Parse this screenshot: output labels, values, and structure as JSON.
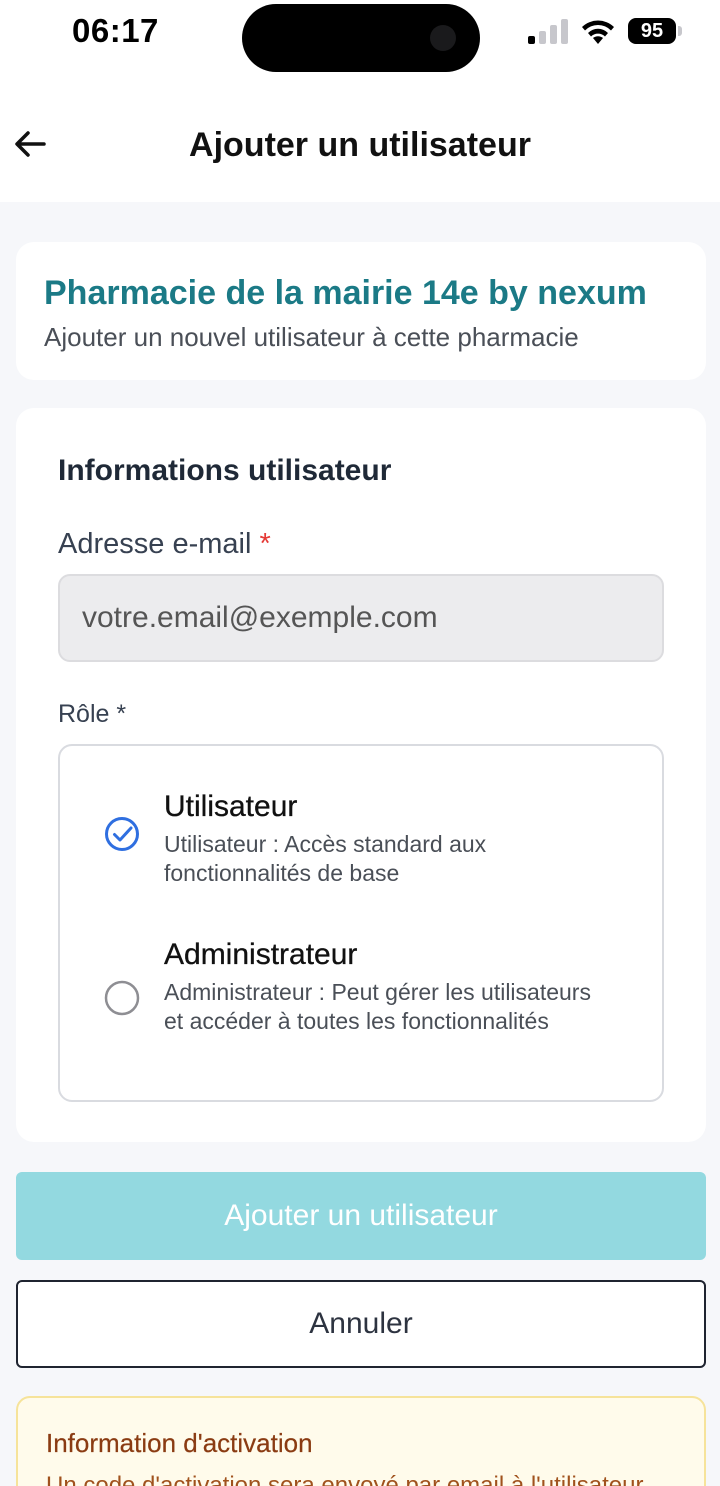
{
  "status_bar": {
    "time": "06:17",
    "battery": "95",
    "icons": [
      "signal-icon",
      "wifi-icon",
      "battery-icon"
    ]
  },
  "nav": {
    "back_icon": "arrow-left-icon",
    "title": "Ajouter un utilisateur"
  },
  "pharmacy": {
    "name": "Pharmacie de la mairie 14e by nexum",
    "subtitle": "Ajouter un nouvel utilisateur à cette pharmacie"
  },
  "form": {
    "section_title": "Informations utilisateur",
    "email": {
      "label": "Adresse e-mail",
      "required_mark": "*",
      "placeholder": "votre.email@exemple.com",
      "value": ""
    },
    "role": {
      "label": "Rôle *",
      "selected": "Utilisateur",
      "options": [
        {
          "name": "Utilisateur",
          "description": "Utilisateur : Accès standard aux fonctionnalités de base",
          "icon": "check-circle-icon"
        },
        {
          "name": "Administrateur",
          "description": "Administrateur : Peut gérer les utilisateurs et accéder à toutes les fonctionnalités",
          "icon": "radio-empty-icon"
        }
      ]
    }
  },
  "actions": {
    "submit_label": "Ajouter un utilisateur",
    "cancel_label": "Annuler"
  },
  "info": {
    "title": "Information d'activation",
    "text": "Un code d'activation sera envoyé par email à l'utilisateur"
  },
  "colors": {
    "brand": "#1b7a86",
    "primary_button": "#93d9e0",
    "selected_radio": "#2f6fe0",
    "required": "#e53935",
    "info_background": "#fffbeb"
  }
}
